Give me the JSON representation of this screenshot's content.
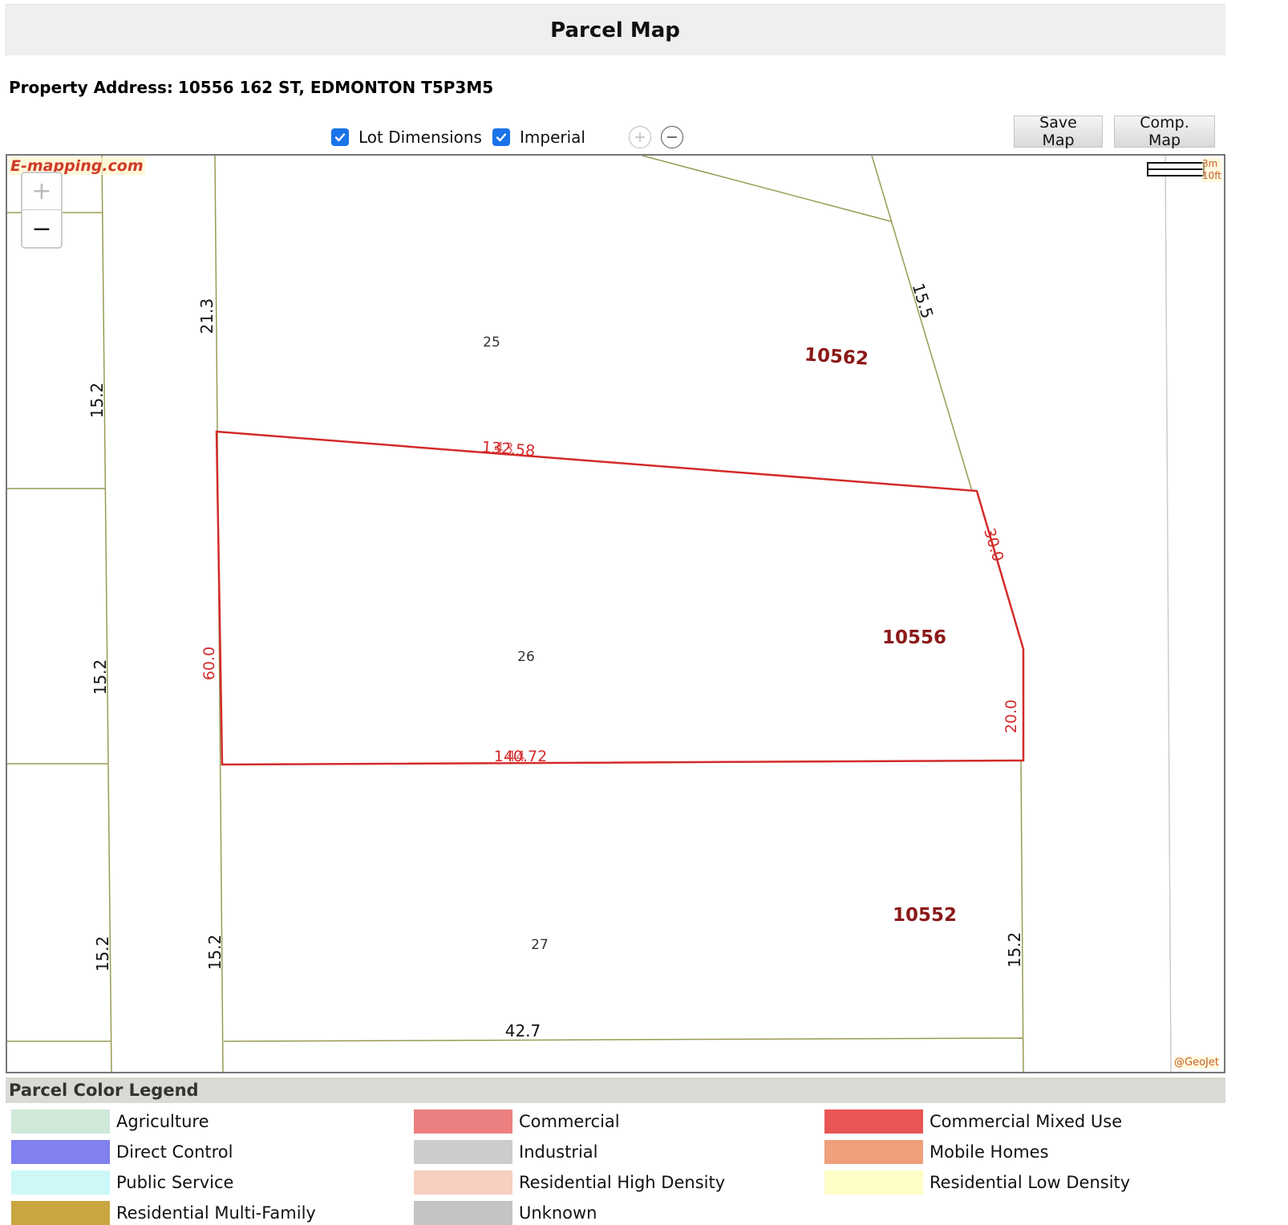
{
  "header": {
    "title": "Parcel Map"
  },
  "property": {
    "label": "Property Address:",
    "address": "10556 162 ST, EDMONTON T5P3M5"
  },
  "controls": {
    "lot_dimensions": {
      "label": "Lot Dimensions",
      "checked": true
    },
    "imperial": {
      "label": "Imperial",
      "checked": true
    },
    "save_map": "Save Map",
    "comp_map": "Comp. Map"
  },
  "map": {
    "brand": "E-mapping.com",
    "zoom_in": "+",
    "zoom_out": "−",
    "scale_metric": "3m",
    "scale_imperial": "10ft",
    "copyright": "@GeoJet",
    "colors": {
      "parcel_line": "#9a9a55",
      "selected_line": "#d42a2a",
      "lot_label": "#8b1a1a"
    },
    "addresses": {
      "north": "10562",
      "selected": "10556",
      "south": "10552"
    },
    "lot_numbers": {
      "north": "25",
      "selected": "26",
      "south": "27"
    },
    "dims": {
      "west_col_1": "15.2",
      "west_col_2": "15.2",
      "west_col_3": "15.2",
      "north_west_side": "21.3",
      "north_east_side": "15.5",
      "south_west_side": "15.2",
      "south_east_side": "15.2",
      "south_bottom": "42.7",
      "sel_top": "132.58",
      "sel_top_overlap": "43",
      "sel_bottom": "140.72",
      "sel_bottom_overlap": "44",
      "sel_left": "60.0",
      "sel_right_upper": "30.0",
      "sel_right_lower": "20.0"
    }
  },
  "legend": {
    "title": "Parcel Color Legend",
    "items": [
      {
        "label": "Agriculture",
        "color": "#cfe8d8"
      },
      {
        "label": "Commercial",
        "color": "#ec8080"
      },
      {
        "label": "Commercial Mixed Use",
        "color": "#e95555"
      },
      {
        "label": "Direct Control",
        "color": "#8080f0"
      },
      {
        "label": "Industrial",
        "color": "#cccccc"
      },
      {
        "label": "Mobile Homes",
        "color": "#f0a07a"
      },
      {
        "label": "Public Service",
        "color": "#ccf8f8"
      },
      {
        "label": "Residential High Density",
        "color": "#f8cfc0"
      },
      {
        "label": "Residential Low Density",
        "color": "#fdfdc8"
      },
      {
        "label": "Residential Multi-Family",
        "color": "#c9a640"
      },
      {
        "label": "Unknown",
        "color": "#c4c4c4"
      }
    ]
  }
}
